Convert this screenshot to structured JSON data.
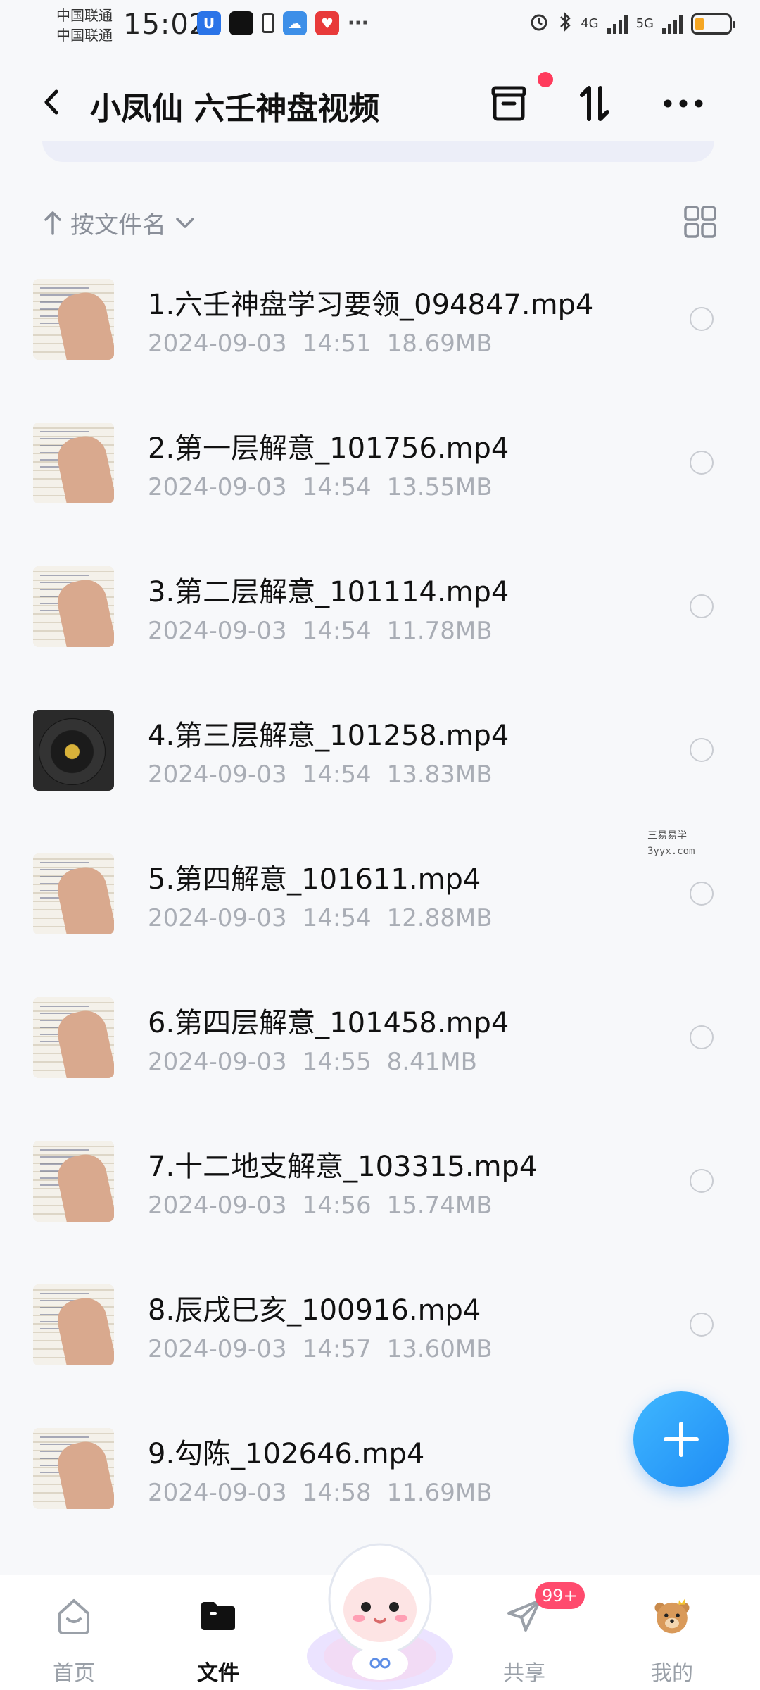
{
  "status_bar": {
    "carrier_1": "中国联通",
    "carrier_2": "中国联通",
    "time": "15:02",
    "network_1": "4G",
    "network_2": "5G",
    "battery_level": 0.25
  },
  "header": {
    "title": "小凤仙 六壬神盘视频"
  },
  "sort": {
    "label": "按文件名"
  },
  "files": [
    {
      "name": "1.六壬神盘学习要领_094847.mp4",
      "date": "2024-09-03",
      "time": "14:51",
      "size": "18.69MB",
      "thumb": "notes"
    },
    {
      "name": "2.第一层解意_101756.mp4",
      "date": "2024-09-03",
      "time": "14:54",
      "size": "13.55MB",
      "thumb": "notes"
    },
    {
      "name": "3.第二层解意_101114.mp4",
      "date": "2024-09-03",
      "time": "14:54",
      "size": "11.78MB",
      "thumb": "notes"
    },
    {
      "name": "4.第三层解意_101258.mp4",
      "date": "2024-09-03",
      "time": "14:54",
      "size": "13.83MB",
      "thumb": "disc"
    },
    {
      "name": "5.第四解意_101611.mp4",
      "date": "2024-09-03",
      "time": "14:54",
      "size": "12.88MB",
      "thumb": "notes"
    },
    {
      "name": "6.第四层解意_101458.mp4",
      "date": "2024-09-03",
      "time": "14:55",
      "size": "8.41MB",
      "thumb": "notes"
    },
    {
      "name": "7.十二地支解意_103315.mp4",
      "date": "2024-09-03",
      "time": "14:56",
      "size": "15.74MB",
      "thumb": "notes"
    },
    {
      "name": "8.辰戌巳亥_100916.mp4",
      "date": "2024-09-03",
      "time": "14:57",
      "size": "13.60MB",
      "thumb": "notes"
    },
    {
      "name": "9.勾陈_102646.mp4",
      "date": "2024-09-03",
      "time": "14:58",
      "size": "11.69MB",
      "thumb": "notes"
    }
  ],
  "watermark": {
    "line1": "三易易学",
    "line2": "3yyx.com"
  },
  "bottom_nav": {
    "home": "首页",
    "files": "文件",
    "share": "共享",
    "share_badge": "99+",
    "mine": "我的"
  },
  "colors": {
    "accent": "#1f8cf5",
    "badge": "#ff4b6e",
    "meta_text": "#a9adb5"
  }
}
